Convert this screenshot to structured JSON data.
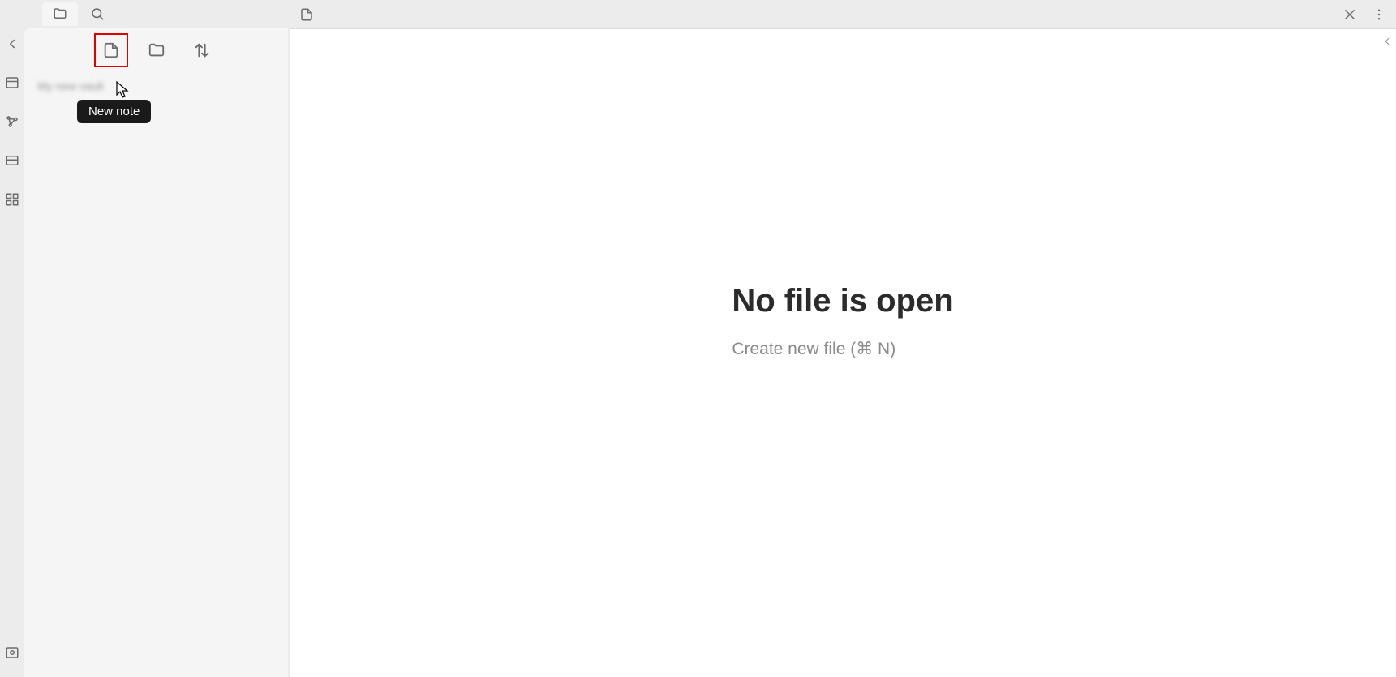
{
  "sidebar": {
    "tabs": {
      "files_active": true
    },
    "toolbar": {
      "new_note_tooltip": "New note"
    },
    "vault_name": "My new vault"
  },
  "main": {
    "empty": {
      "title": "No file is open",
      "subtitle": "Create new file (⌘ N)"
    }
  }
}
